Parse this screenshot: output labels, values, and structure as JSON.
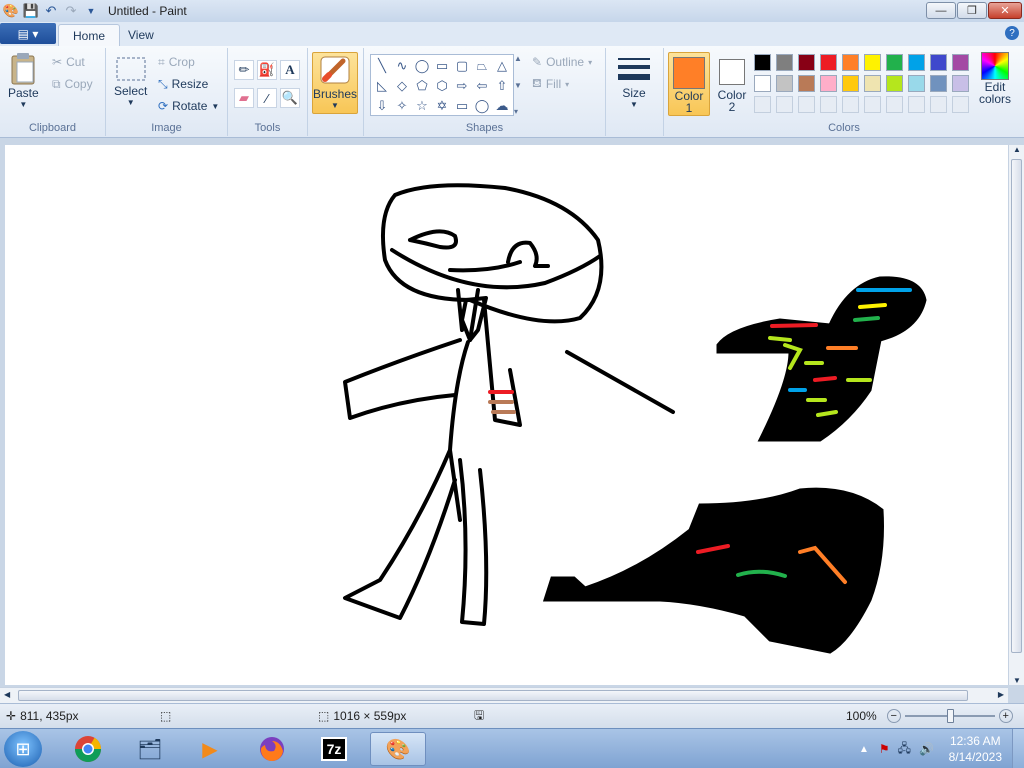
{
  "window": {
    "title": "Untitled - Paint",
    "minimize_glyph": "—",
    "restore_glyph": "❐",
    "close_glyph": "✕"
  },
  "tabs": [
    {
      "label": "Home",
      "active": true
    },
    {
      "label": "View",
      "active": false
    }
  ],
  "ribbon": {
    "clipboard": {
      "group": "Clipboard",
      "paste": "Paste",
      "cut": "Cut",
      "copy": "Copy"
    },
    "image": {
      "group": "Image",
      "select": "Select",
      "crop": "Crop",
      "resize": "Resize",
      "rotate": "Rotate"
    },
    "tools": {
      "group": "Tools"
    },
    "brushes": {
      "label": "Brushes"
    },
    "shapes": {
      "group": "Shapes",
      "outline": "Outline",
      "fill": "Fill"
    },
    "size": {
      "label": "Size"
    },
    "colors": {
      "group": "Colors",
      "color1_label": "Color",
      "color1_num": "1",
      "color2_label": "Color",
      "color2_num": "2",
      "color1": "#ff7f27",
      "color2": "#ffffff",
      "edit_label1": "Edit",
      "edit_label2": "colors",
      "palette_row1": [
        "#000000",
        "#7f7f7f",
        "#880015",
        "#ed1c24",
        "#ff7f27",
        "#fff200",
        "#22b14c",
        "#00a2e8",
        "#3f48cc",
        "#a349a4"
      ],
      "palette_row2": [
        "#ffffff",
        "#c3c3c3",
        "#b97a57",
        "#ffaec9",
        "#ffc90e",
        "#efe4b0",
        "#b5e61d",
        "#99d9ea",
        "#7092be",
        "#c8bfe7"
      ]
    }
  },
  "status": {
    "cursor_pos": "811, 435px",
    "canvas_size": "1016 × 559px",
    "zoom": "100%"
  },
  "taskbar": {
    "time": "12:36 AM",
    "date": "8/14/2023"
  }
}
